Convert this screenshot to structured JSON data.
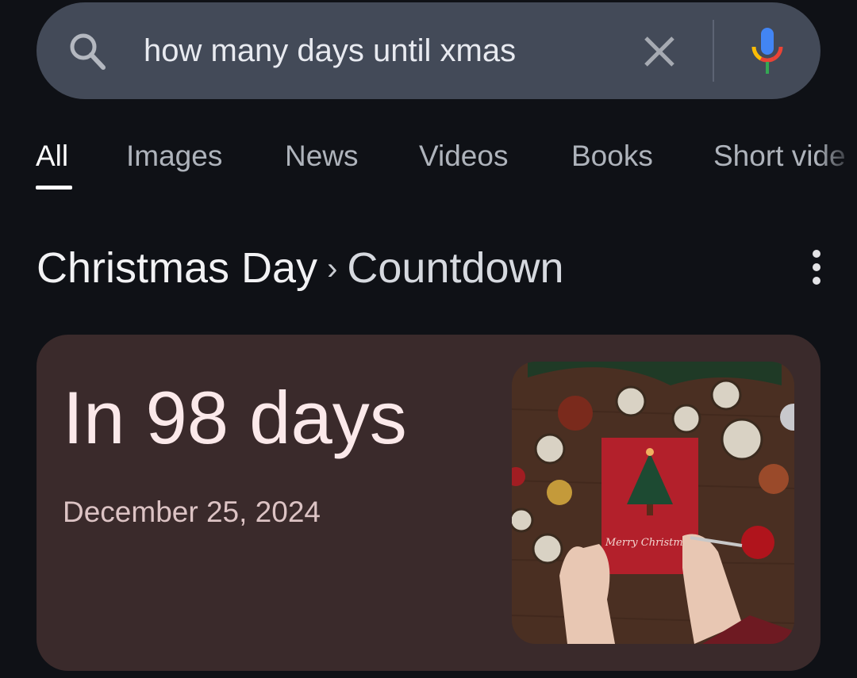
{
  "search": {
    "query": "how many days until xmas",
    "icons": [
      "search-icon",
      "close-icon",
      "mic-icon"
    ]
  },
  "tabs": [
    {
      "label": "All",
      "active": true
    },
    {
      "label": "Images"
    },
    {
      "label": "News"
    },
    {
      "label": "Videos"
    },
    {
      "label": "Books"
    },
    {
      "label": "Short vide"
    }
  ],
  "heading": {
    "title": "Christmas Day",
    "separator": "›",
    "subtitle": "Countdown"
  },
  "card": {
    "countdown": "In 98 days",
    "date": "December 25, 2024",
    "image_text": "Merry Christmas"
  },
  "colors": {
    "background": "#0f1116",
    "search_bar": "#434a58",
    "card": "#3a2a2b",
    "mic_blue": "#4285f4",
    "mic_red": "#ea4335",
    "mic_yellow": "#fbbc05",
    "mic_green": "#34a853"
  }
}
